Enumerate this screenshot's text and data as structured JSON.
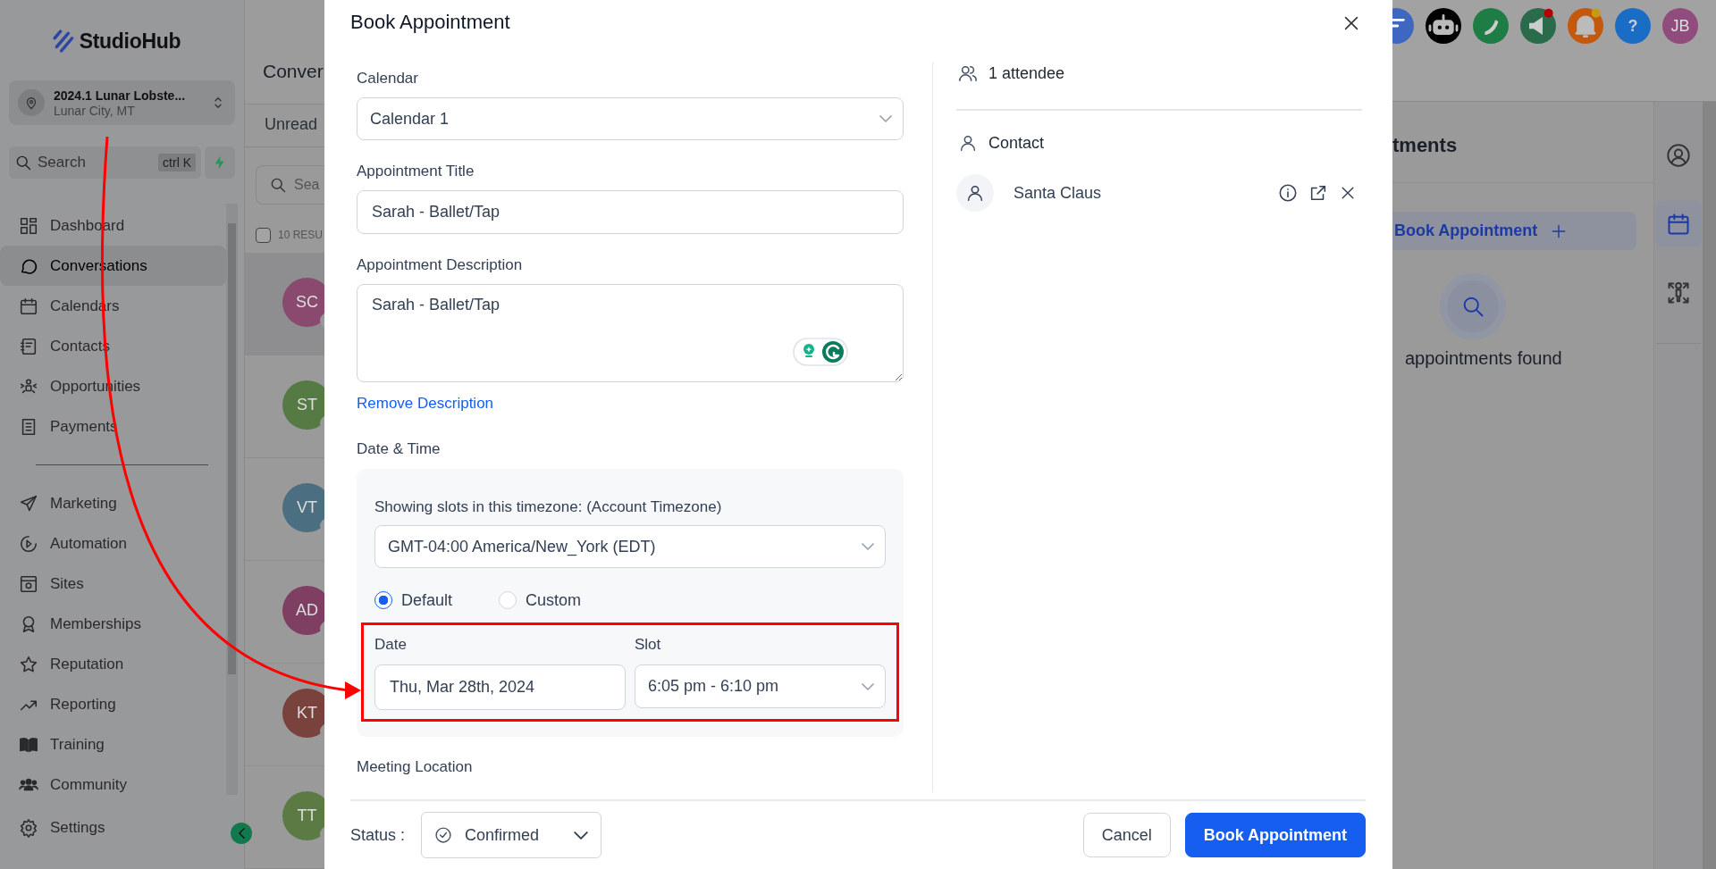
{
  "sidebar": {
    "logo": "StudioHub",
    "account": {
      "name": "2024.1 Lunar Lobste...",
      "location": "Lunar City, MT"
    },
    "search": {
      "placeholder": "Search",
      "shortcut": "ctrl K"
    },
    "nav_groups": [
      [
        {
          "label": "Dashboard",
          "selected": false
        },
        {
          "label": "Conversations",
          "selected": true
        },
        {
          "label": "Calendars",
          "selected": false
        },
        {
          "label": "Contacts",
          "selected": false
        },
        {
          "label": "Opportunities",
          "selected": false
        },
        {
          "label": "Payments",
          "selected": false
        }
      ],
      [
        {
          "label": "Marketing",
          "selected": false
        },
        {
          "label": "Automation",
          "selected": false
        },
        {
          "label": "Sites",
          "selected": false
        },
        {
          "label": "Memberships",
          "selected": false
        },
        {
          "label": "Reputation",
          "selected": false
        },
        {
          "label": "Reporting",
          "selected": false
        },
        {
          "label": "Training",
          "selected": false
        },
        {
          "label": "Community",
          "selected": false
        }
      ]
    ],
    "settings": "Settings"
  },
  "conversations": {
    "title": "Conver",
    "tab": "Unread",
    "search_placeholder": "Sea",
    "results": "10 RESU",
    "select_all_checked": false,
    "rows": [
      {
        "initials": "SC",
        "color": "#8a4a70",
        "selected": true
      },
      {
        "initials": "ST",
        "color": "#557a44",
        "selected": false
      },
      {
        "initials": "VT",
        "color": "#4b6f80",
        "selected": false
      },
      {
        "initials": "AD",
        "color": "#7f3f62",
        "selected": false
      },
      {
        "initials": "KT",
        "color": "#7a423c",
        "selected": false
      },
      {
        "initials": "TT",
        "color": "#5c7a44",
        "selected": false
      }
    ]
  },
  "topbar": {
    "help": "?",
    "avatar": "JB"
  },
  "modal": {
    "title": "Book Appointment",
    "calendar": {
      "label": "Calendar",
      "value": "Calendar 1"
    },
    "appointment_title": {
      "label": "Appointment Title",
      "value": "Sarah - Ballet/Tap"
    },
    "description": {
      "label": "Appointment Description",
      "value": "Sarah - Ballet/Tap"
    },
    "remove_link": "Remove Description",
    "date_time": {
      "label": "Date & Time",
      "timezone_caption": "Showing slots in this timezone: (Account Timezone)",
      "timezone": "GMT-04:00 America/New_York (EDT)",
      "options": [
        {
          "label": "Default",
          "selected": true
        },
        {
          "label": "Custom",
          "selected": false
        }
      ],
      "date": {
        "label": "Date",
        "value": "Thu, Mar 28th, 2024"
      },
      "slot": {
        "label": "Slot",
        "value": "6:05 pm - 6:10 pm"
      }
    },
    "meeting_location": "Meeting Location",
    "attendees": {
      "count": "1 attendee",
      "contact_label": "Contact",
      "contact_name": "Santa Claus"
    },
    "footer": {
      "status_label": "Status :",
      "status": "Confirmed",
      "cancel": "Cancel",
      "submit": "Book Appointment"
    }
  },
  "appointments_panel": {
    "title": "tments",
    "book_button": "Book Appointment",
    "empty_text": "appointments found"
  },
  "right_rail": [
    {
      "selected": false
    },
    {
      "selected": true
    },
    {
      "selected": false
    }
  ]
}
